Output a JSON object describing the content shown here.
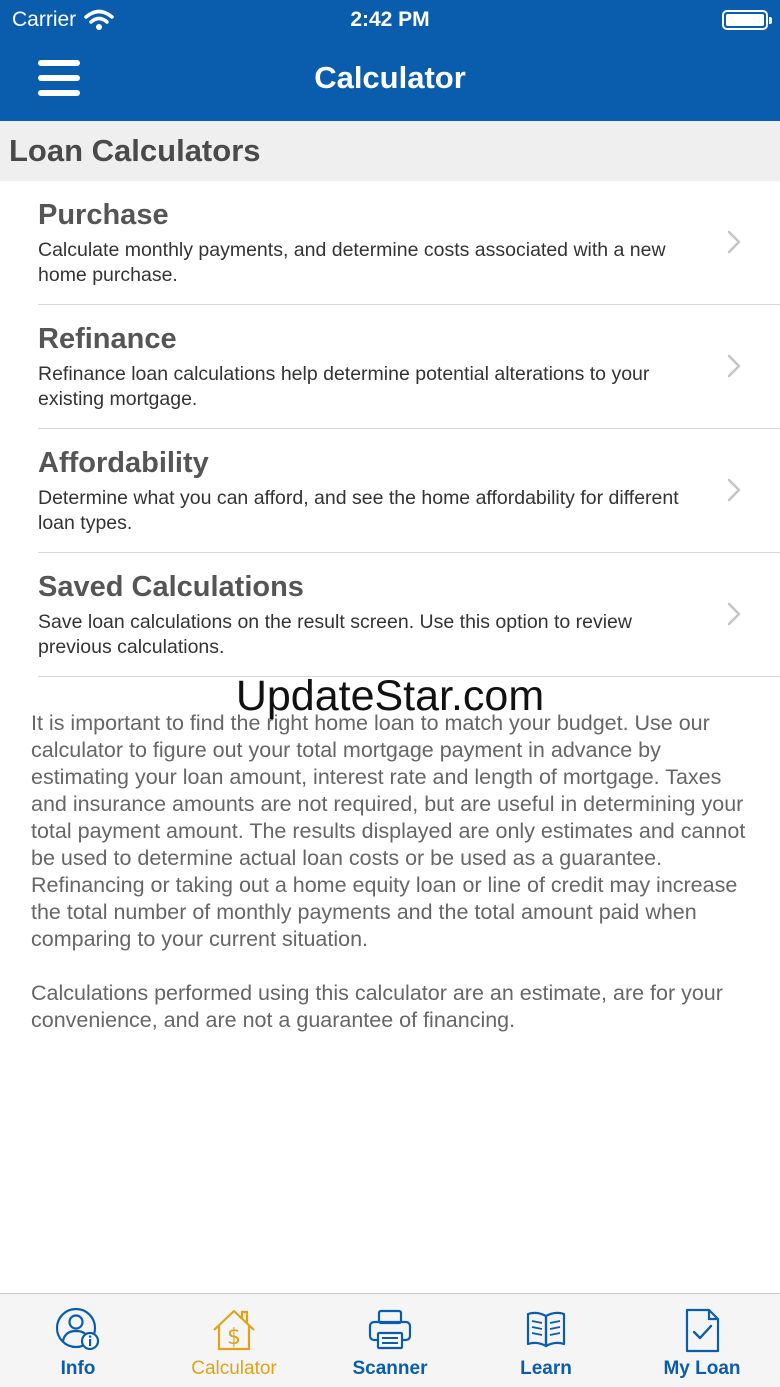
{
  "status_bar": {
    "carrier": "Carrier",
    "time": "2:42 PM"
  },
  "nav": {
    "title": "Calculator"
  },
  "section": {
    "title": "Loan Calculators"
  },
  "items": [
    {
      "title": "Purchase",
      "desc": "Calculate monthly payments, and determine costs associated with a new home purchase."
    },
    {
      "title": "Refinance",
      "desc": "Refinance loan calculations help determine potential alterations to your existing mortgage."
    },
    {
      "title": "Affordability",
      "desc": "Determine what you can afford, and see the home affordability for different loan types."
    },
    {
      "title": "Saved Calculations",
      "desc": "Save loan calculations on the result screen. Use this option to review previous calculations."
    }
  ],
  "watermark": "UpdateStar.com",
  "body": {
    "text": "It is important to find the right home loan to match your budget. Use our calculator to figure out your total mortgage payment in advance by estimating your loan amount, interest rate and length of mortgage. Taxes and insurance amounts are not required, but are useful in determining your total payment amount.  The results displayed are only estimates and cannot be used to determine actual loan costs or be used as a guarantee. Refinancing or taking out a home equity loan or line of credit may increase the total number of monthly payments and the total amount paid when comparing to your current situation.\n\nCalculations performed using this calculator are an estimate, are for your convenience, and are not a guarantee of financing."
  },
  "tabs": [
    {
      "label": "Info",
      "icon": "user-info-icon"
    },
    {
      "label": "Calculator",
      "icon": "house-dollar-icon",
      "active": true
    },
    {
      "label": "Scanner",
      "icon": "printer-icon"
    },
    {
      "label": "Learn",
      "icon": "book-icon"
    },
    {
      "label": "My Loan",
      "icon": "document-check-icon"
    }
  ],
  "colors": {
    "brand": "#0a5dad",
    "active_tab": "#e0a316"
  }
}
